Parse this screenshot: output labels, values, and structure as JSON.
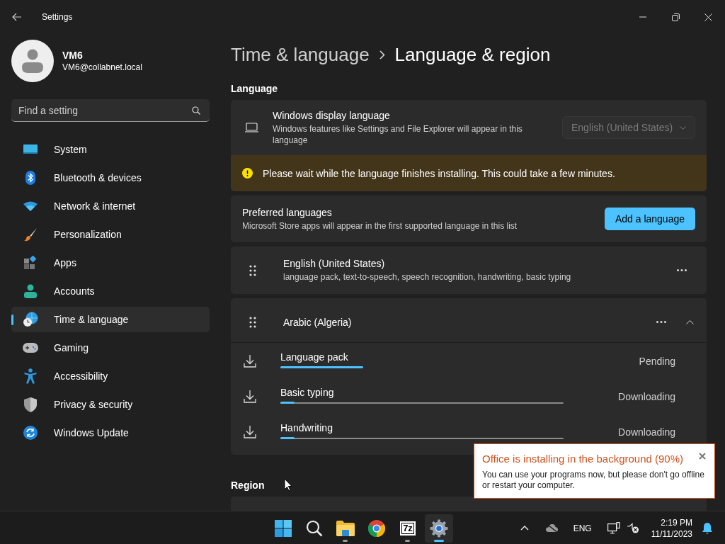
{
  "window": {
    "title": "Settings"
  },
  "user": {
    "name": "VM6",
    "email": "VM6@collabnet.local"
  },
  "search": {
    "placeholder": "Find a setting"
  },
  "nav": [
    {
      "label": "System",
      "selected": false
    },
    {
      "label": "Bluetooth & devices",
      "selected": false
    },
    {
      "label": "Network & internet",
      "selected": false
    },
    {
      "label": "Personalization",
      "selected": false
    },
    {
      "label": "Apps",
      "selected": false
    },
    {
      "label": "Accounts",
      "selected": false
    },
    {
      "label": "Time & language",
      "selected": true
    },
    {
      "label": "Gaming",
      "selected": false
    },
    {
      "label": "Accessibility",
      "selected": false
    },
    {
      "label": "Privacy & security",
      "selected": false
    },
    {
      "label": "Windows Update",
      "selected": false
    }
  ],
  "breadcrumb": [
    "Time & language",
    "Language & region"
  ],
  "language_heading": "Language",
  "display_language": {
    "title": "Windows display language",
    "description": "Windows features like Settings and File Explorer will appear in this language",
    "value": "English (United States)",
    "disabled": true
  },
  "warning": "Please wait while the language finishes installing. This could take a few minutes.",
  "preferred": {
    "title": "Preferred languages",
    "description": "Microsoft Store apps will appear in the first supported language in this list",
    "button": "Add a language"
  },
  "languages": [
    {
      "name": "English (United States)",
      "features": "language pack, text-to-speech, speech recognition, handwriting, basic typing",
      "expanded": false
    },
    {
      "name": "Arabic (Algeria)",
      "expanded": true,
      "components": [
        {
          "name": "Language pack",
          "status": "Pending",
          "kind": "indeterminate"
        },
        {
          "name": "Basic typing",
          "status": "Downloading",
          "kind": "progress",
          "level": 0.05
        },
        {
          "name": "Handwriting",
          "status": "Downloading",
          "kind": "progress",
          "level": 0.05
        }
      ]
    }
  ],
  "region_heading": "Region",
  "toast": {
    "title": "Office is installing in the background (90%)",
    "body": "You can use your programs now, but please don't go offline or restart your computer."
  },
  "taskbar": {
    "apps": [
      {
        "kind": "start",
        "running": false,
        "active": false
      },
      {
        "kind": "search",
        "running": false,
        "active": false
      },
      {
        "kind": "explorer",
        "running": true,
        "active": false
      },
      {
        "kind": "chrome",
        "running": false,
        "active": false
      },
      {
        "kind": "archiver",
        "label": "7z",
        "running": true,
        "active": false
      },
      {
        "kind": "settings",
        "running": true,
        "active": true
      }
    ],
    "language": "ENG",
    "time": "2:19 PM",
    "date": "11/11/2023"
  }
}
